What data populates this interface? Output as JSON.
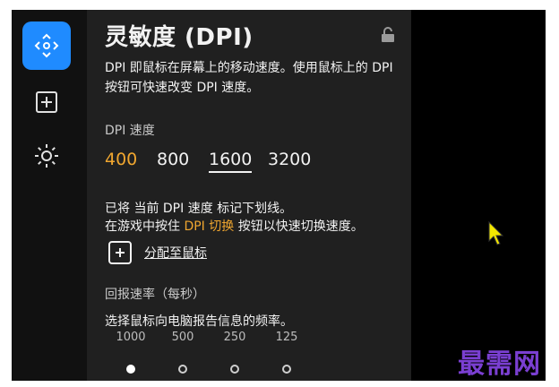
{
  "panel": {
    "title": "灵敏度 (DPI)",
    "description": "DPI 即鼠标在屏幕上的移动速度。使用鼠标上的 DPI 按钮可快速改变 DPI 速度。",
    "dpi_speed_label": "DPI 速度",
    "dpi_values": [
      "400",
      "800",
      "1600",
      "3200"
    ],
    "dpi_current_index": 0,
    "dpi_underlined_index": 2,
    "note_line1": "已将 当前 DPI 速度 标记下划线。",
    "note_line2_prefix": "在游戏中按住 ",
    "note_line2_highlight": "DPI 切换",
    "note_line2_suffix": " 按钮以快速切换速度。",
    "assign_label": "分配至鼠标",
    "report_rate_label": "回报速率（每秒）",
    "report_rate_description": "选择鼠标向电脑报告信息的频率。",
    "report_rates": [
      "1000",
      "500",
      "250",
      "125"
    ],
    "report_rate_selected_index": 0
  },
  "sidebar": {
    "items": [
      {
        "icon": "move-arrows-icon",
        "active": true
      },
      {
        "icon": "plus-square-icon",
        "active": false
      },
      {
        "icon": "sun-gear-icon",
        "active": false
      }
    ]
  },
  "watermark": "最需网",
  "colors": {
    "accent": "#1f8bff",
    "highlight": "#f0a62f",
    "panel_bg": "#202020",
    "watermark": "#7a3fd1",
    "cursor": "#f2e600"
  }
}
